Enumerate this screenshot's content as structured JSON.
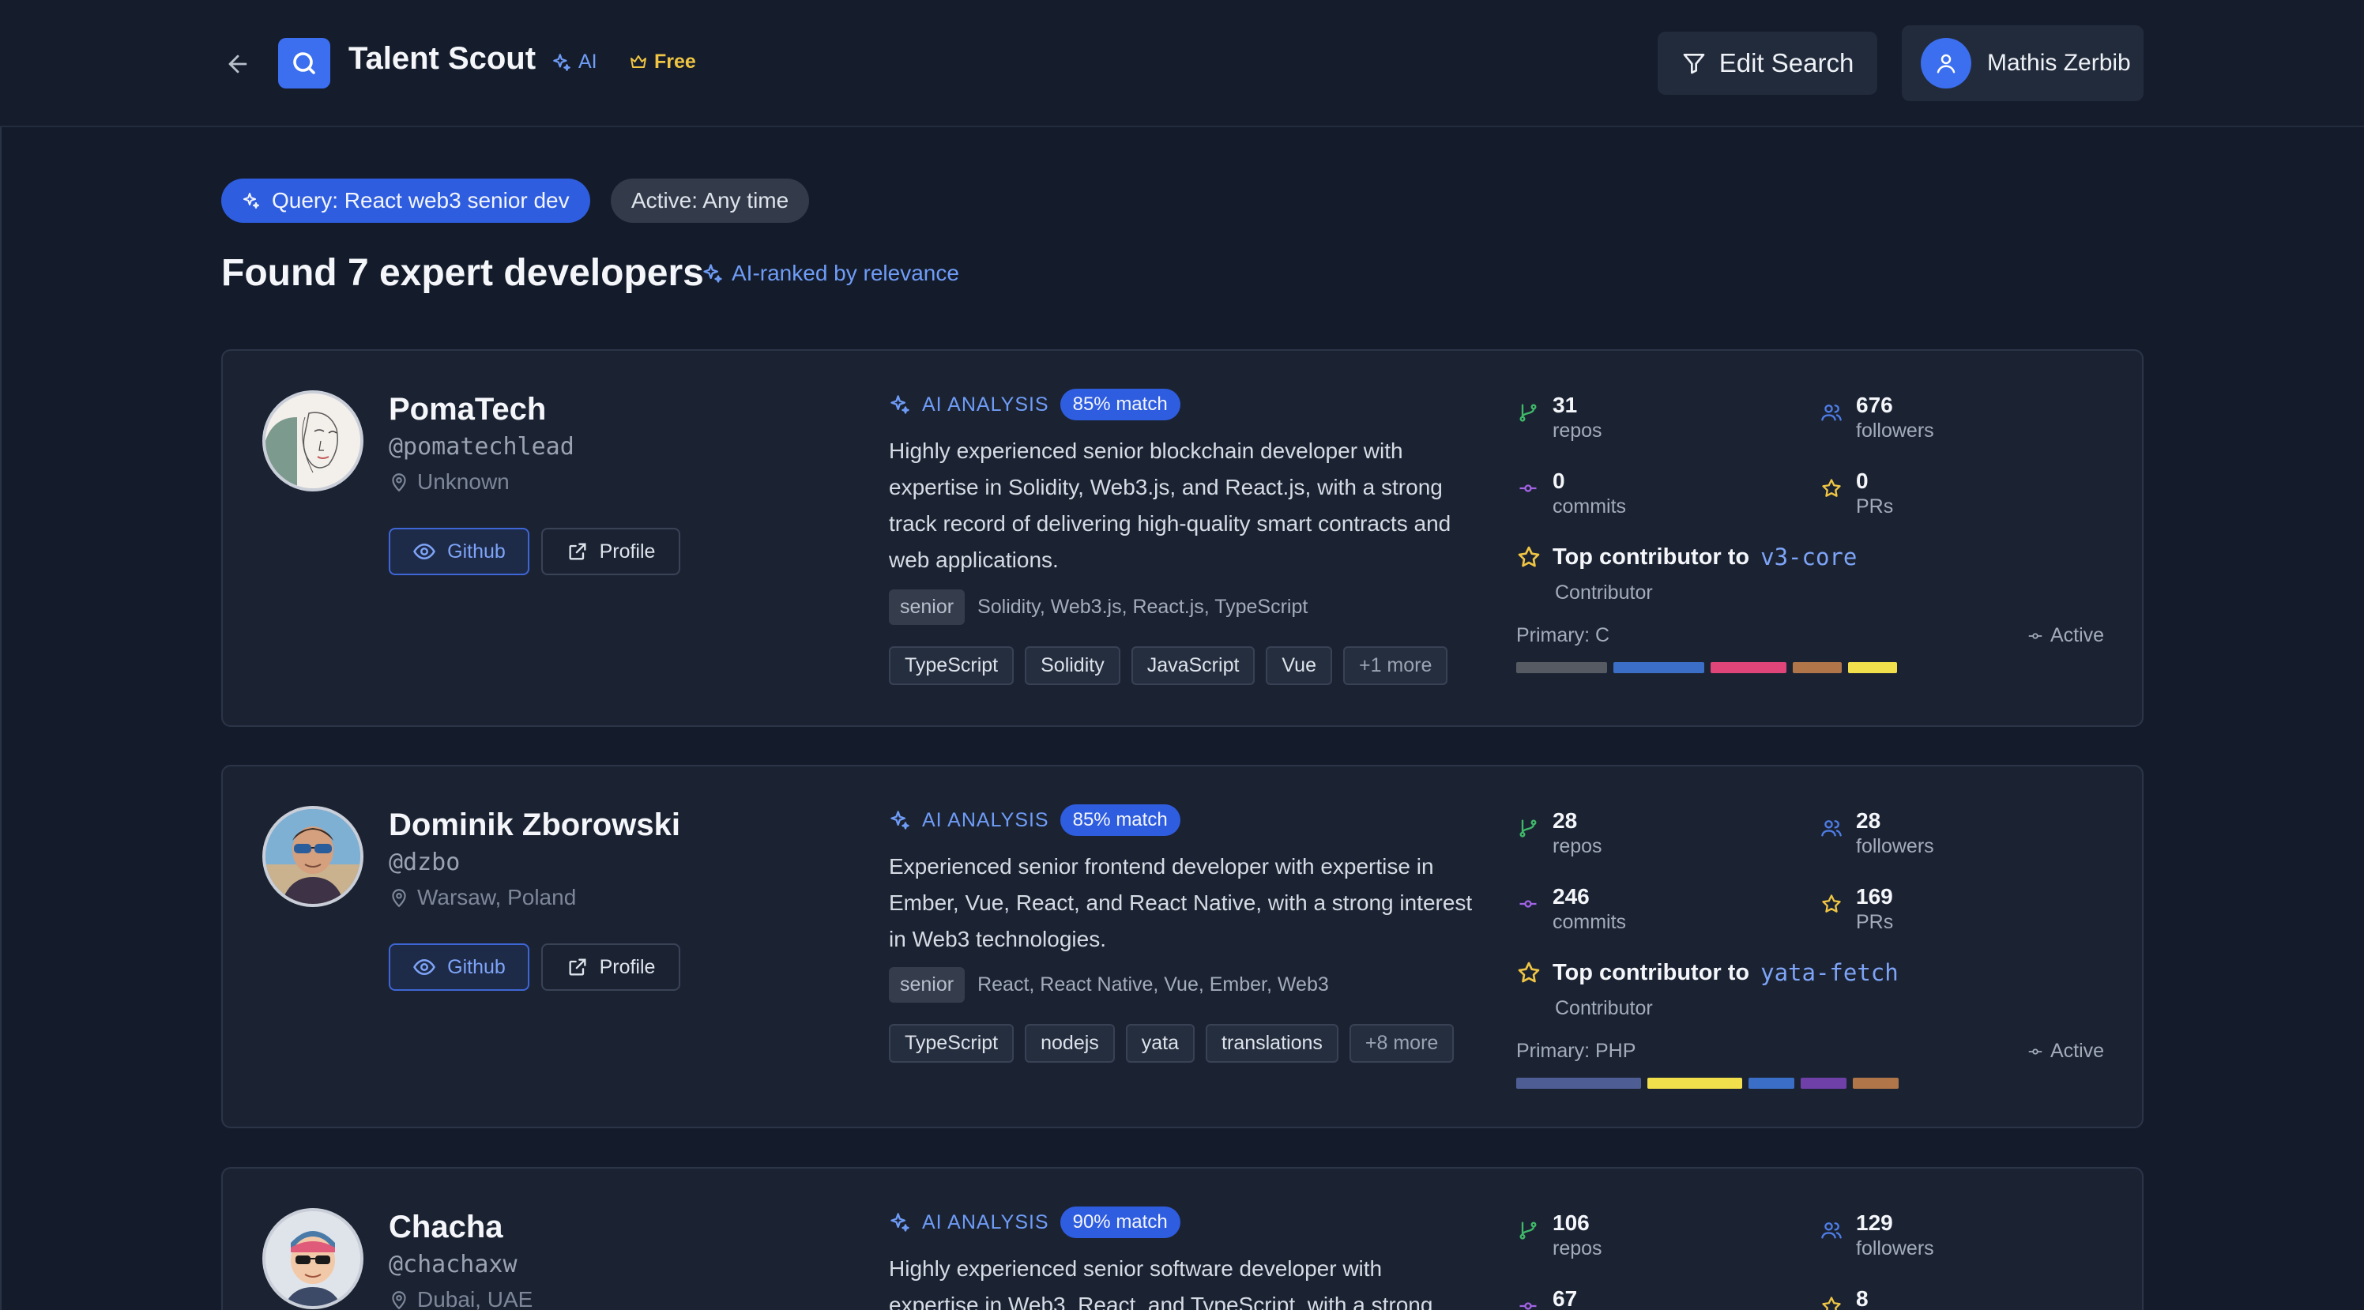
{
  "header": {
    "title": "Talent Scout",
    "ai_label": "AI",
    "plan_label": "Free",
    "edit_search_label": "Edit Search",
    "user_name": "Mathis Zerbib"
  },
  "filters": {
    "query_label": "Query: React web3 senior dev",
    "active_label": "Active: Any time"
  },
  "results": {
    "title": "Found 7 expert developers",
    "ranked_label": "AI-ranked by relevance"
  },
  "common": {
    "github_label": "Github",
    "profile_label": "Profile",
    "ai_analysis_label": "AI ANALYSIS",
    "repos_label": "repos",
    "followers_label": "followers",
    "commits_label": "commits",
    "prs_label": "PRs",
    "top_contributor_label": "Top contributor to",
    "contributor_label": "Contributor",
    "active_label": "Active"
  },
  "colors": {
    "accent": "#3b6ff0",
    "brand_yellow": "#f0c543"
  },
  "developers": [
    {
      "name": "PomaTech",
      "handle": "@pomatechlead",
      "location": "Unknown",
      "match": "85% match",
      "analysis": "Highly experienced senior blockchain developer with expertise in Solidity, Web3.js, and React.js, with a strong track record of delivering high-quality smart contracts and web applications.",
      "level": "senior",
      "skills": "Solidity, Web3.js, React.js, TypeScript",
      "tags": [
        "TypeScript",
        "Solidity",
        "JavaScript",
        "Vue",
        "+1 more"
      ],
      "repos": "31",
      "followers": "676",
      "commits": "0",
      "prs": "0",
      "top_repo": "v3-core",
      "primary": "Primary: C",
      "languages": [
        {
          "color": "#555a63",
          "share": 0.24
        },
        {
          "color": "#3b6fc7",
          "share": 0.24
        },
        {
          "color": "#e0457a",
          "share": 0.2
        },
        {
          "color": "#b07548",
          "share": 0.13
        },
        {
          "color": "#f1df4b",
          "share": 0.13
        }
      ]
    },
    {
      "name": "Dominik Zborowski",
      "handle": "@dzbo",
      "location": "Warsaw, Poland",
      "match": "85% match",
      "analysis": "Experienced senior frontend developer with expertise in Ember, Vue, React, and React Native, with a strong interest in Web3 technologies.",
      "level": "senior",
      "skills": "React, React Native, Vue, Ember, Web3",
      "tags": [
        "TypeScript",
        "nodejs",
        "yata",
        "translations",
        "+8 more"
      ],
      "repos": "28",
      "followers": "28",
      "commits": "246",
      "prs": "169",
      "top_repo": "yata-fetch",
      "primary": "Primary: PHP",
      "languages": [
        {
          "color": "#4f5d95",
          "share": 0.33
        },
        {
          "color": "#f1df4b",
          "share": 0.25
        },
        {
          "color": "#3b6fc7",
          "share": 0.12
        },
        {
          "color": "#6e40a8",
          "share": 0.12
        },
        {
          "color": "#b07548",
          "share": 0.12
        }
      ]
    },
    {
      "name": "Chacha",
      "handle": "@chachaxw",
      "location": "Dubai, UAE",
      "match": "90% match",
      "analysis": "Highly experienced senior software developer with expertise in Web3, React, and TypeScript, with a strong",
      "repos": "106",
      "followers": "129",
      "commits": "67",
      "prs": "8"
    }
  ]
}
